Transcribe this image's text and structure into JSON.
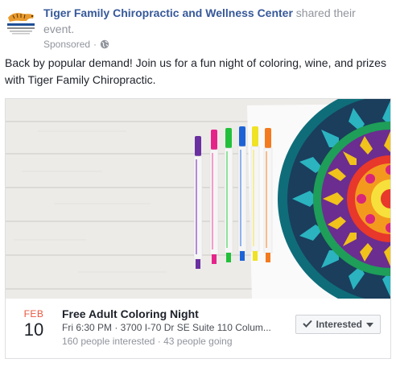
{
  "post": {
    "page_name": "Tiger Family Chiropractic and Wellness Center",
    "action_text": " shared their event.",
    "sponsored_label": "Sponsored",
    "separator": " · ",
    "body_text": "Back by popular demand! Join us for a fun night of coloring, wine, and prizes with Tiger Family Chiropractic."
  },
  "icons": {
    "avatar": "tiger-logo",
    "privacy": "globe-icon",
    "check": "check-icon",
    "dropdown": "caret-down-icon"
  },
  "event": {
    "month": "Feb",
    "day": "10",
    "title": "Free Adult Coloring Night",
    "details": "Fri 6:30 PM · 3700 I-70 Dr SE Suite 110 Colum...",
    "stats": "160 people interested · 43 people going",
    "button_label": "Interested"
  },
  "colors": {
    "link": "#365899",
    "meta": "#90949c",
    "month": "#e9573f"
  }
}
